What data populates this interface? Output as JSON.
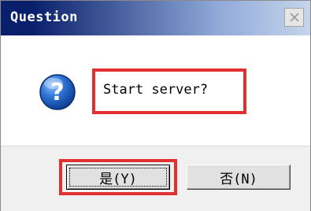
{
  "dialog": {
    "title": "Question",
    "close_icon": "close-icon",
    "icon": "question-icon",
    "message": "Start server?",
    "buttons": {
      "yes_label": "是(Y)",
      "no_label": "否(N)"
    }
  },
  "colors": {
    "titlebar_start": "#0a1f6b",
    "titlebar_end": "#c6d5ec",
    "highlight": "#e03030",
    "icon_blue": "#1f5fbf"
  }
}
